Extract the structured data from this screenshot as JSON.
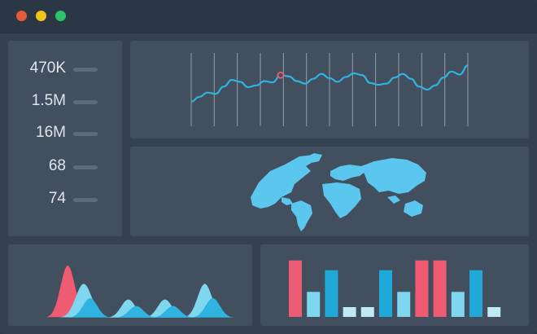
{
  "colors": {
    "accent_cyan": "#2fb3e0",
    "light_cyan": "#7fd6ef",
    "pale_cyan": "#bfe9f5",
    "pink": "#ef5b73",
    "map_blue": "#5bc6ee"
  },
  "stats": [
    {
      "value": "470K",
      "bar_fraction": 1
    },
    {
      "value": "1.5M",
      "bar_fraction": 1
    },
    {
      "value": "16M",
      "bar_fraction": 1
    },
    {
      "value": "68",
      "bar_fraction": 1
    },
    {
      "value": "74",
      "bar_fraction": 1
    }
  ],
  "chart_data": [
    {
      "type": "line",
      "x": [
        0,
        1,
        2,
        3,
        4,
        5,
        6,
        7,
        8,
        9,
        10,
        11,
        12,
        13,
        14,
        15,
        16,
        17,
        18,
        19,
        20,
        21,
        22,
        23,
        24,
        25,
        26,
        27,
        28,
        29,
        30,
        31,
        32,
        33,
        34
      ],
      "values": [
        30,
        38,
        45,
        43,
        55,
        66,
        63,
        54,
        57,
        64,
        62,
        74,
        72,
        64,
        60,
        68,
        76,
        69,
        63,
        71,
        77,
        74,
        61,
        58,
        60,
        70,
        76,
        68,
        55,
        50,
        57,
        70,
        80,
        75,
        90
      ],
      "highlight_index": 11,
      "vertical_lines": 13,
      "ylim": [
        0,
        100
      ]
    },
    {
      "type": "area",
      "series": [
        {
          "color": "#ef5b73",
          "peaks": [
            {
              "center": 1.7,
              "height": 80,
              "width": 0.45
            }
          ]
        },
        {
          "color": "#7fd6ef",
          "peaks": [
            {
              "center": 2.7,
              "height": 52,
              "width": 0.5
            },
            {
              "center": 5.5,
              "height": 28,
              "width": 0.45
            },
            {
              "center": 7.8,
              "height": 28,
              "width": 0.45
            },
            {
              "center": 10.3,
              "height": 52,
              "width": 0.45
            }
          ]
        },
        {
          "color": "#2fb3e0",
          "peaks": [
            {
              "center": 3.1,
              "height": 30,
              "width": 0.45
            },
            {
              "center": 6.0,
              "height": 18,
              "width": 0.45
            },
            {
              "center": 8.3,
              "height": 18,
              "width": 0.45
            },
            {
              "center": 10.8,
              "height": 30,
              "width": 0.45
            }
          ]
        }
      ],
      "xlim": [
        0,
        12
      ],
      "ylim": [
        0,
        100
      ]
    },
    {
      "type": "bar",
      "values": [
        52,
        23,
        43,
        9,
        9,
        43,
        23,
        52,
        52,
        23,
        43,
        9
      ],
      "colors": [
        "#ef5b73",
        "#7fd6ef",
        "#1fa8d8",
        "#bfe9f5",
        "#bfe9f5",
        "#1fa8d8",
        "#7fd6ef",
        "#ef5b73",
        "#ef5b73",
        "#7fd6ef",
        "#1fa8d8",
        "#bfe9f5"
      ],
      "ylim": [
        0,
        60
      ]
    }
  ]
}
